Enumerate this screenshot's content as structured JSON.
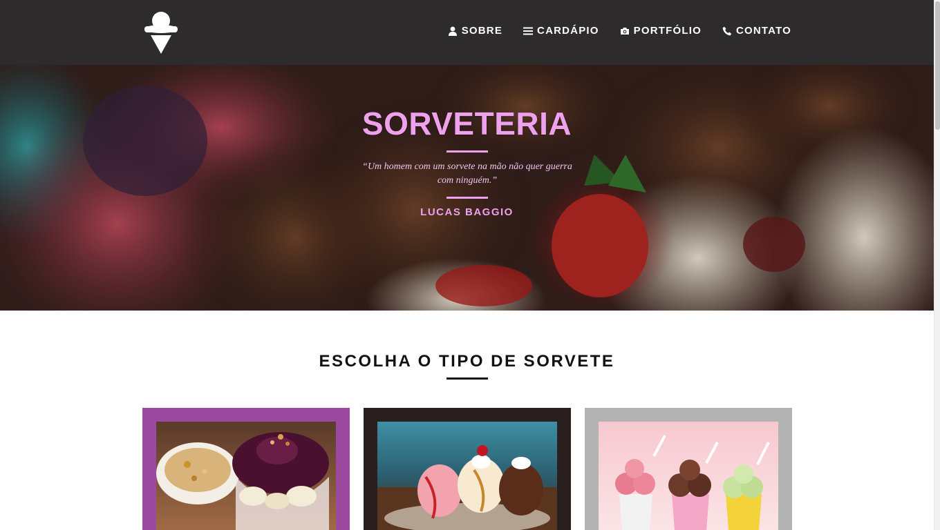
{
  "brand": {
    "logo_icon": "ice-cream-cone-icon"
  },
  "nav": {
    "items": [
      {
        "label": "SOBRE",
        "icon": "user-icon"
      },
      {
        "label": "CARDÁPIO",
        "icon": "menu-lines-icon"
      },
      {
        "label": "PORTFÓLIO",
        "icon": "camera-icon"
      },
      {
        "label": "CONTATO",
        "icon": "phone-icon"
      }
    ]
  },
  "hero": {
    "title": "SORVETERIA",
    "quote": "“Um homem com um sorvete na mão não quer guerra com ninguém.”",
    "author": "LUCAS BAGGIO",
    "accent_color": "#eea1ec"
  },
  "section": {
    "title": "ESCOLHA O TIPO DE SORVETE",
    "cards": [
      {
        "image": "acai-bowl-photo",
        "frame_color": "#9b4aa0"
      },
      {
        "image": "banana-split-photo",
        "frame_color": "#2a1f1f"
      },
      {
        "image": "ice-cream-cups-photo",
        "frame_color": "#b3b3b3"
      }
    ]
  },
  "colors": {
    "navbar": "#2d2b2b",
    "text_dark": "#111111"
  }
}
